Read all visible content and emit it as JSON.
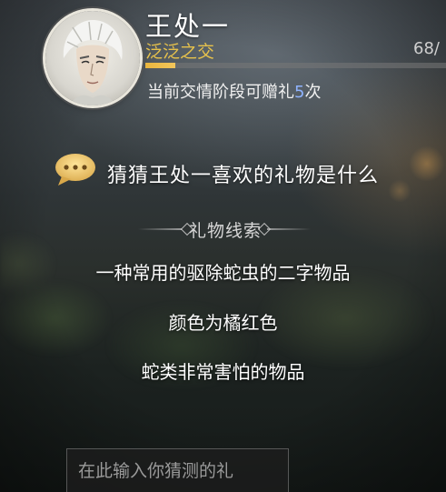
{
  "npc": {
    "name": "王处一",
    "relation": "泛泛之交",
    "score_text": "68/",
    "affinity_fraction": 0.1,
    "gift_text_prefix": "当前交情阶段可赠礼",
    "gift_count": "5",
    "gift_text_suffix": "次"
  },
  "question": {
    "text": "猜猜王处一喜欢的礼物是什么"
  },
  "clues": {
    "title": "礼物线索",
    "items": [
      "一种常用的驱除蛇虫的二字物品",
      "颜色为橘红色",
      "蛇类非常害怕的物品"
    ]
  },
  "input": {
    "placeholder": "在此输入你猜测的礼",
    "value": ""
  },
  "colors": {
    "relation": "#e7c24c",
    "bar_fill": "#e9b53e",
    "gift_count": "#8fb3ff",
    "bubble": "#e8c76a"
  },
  "icons": {
    "bubble": "chat-bubble-icon",
    "ornament": "diamond-ornament-icon"
  }
}
